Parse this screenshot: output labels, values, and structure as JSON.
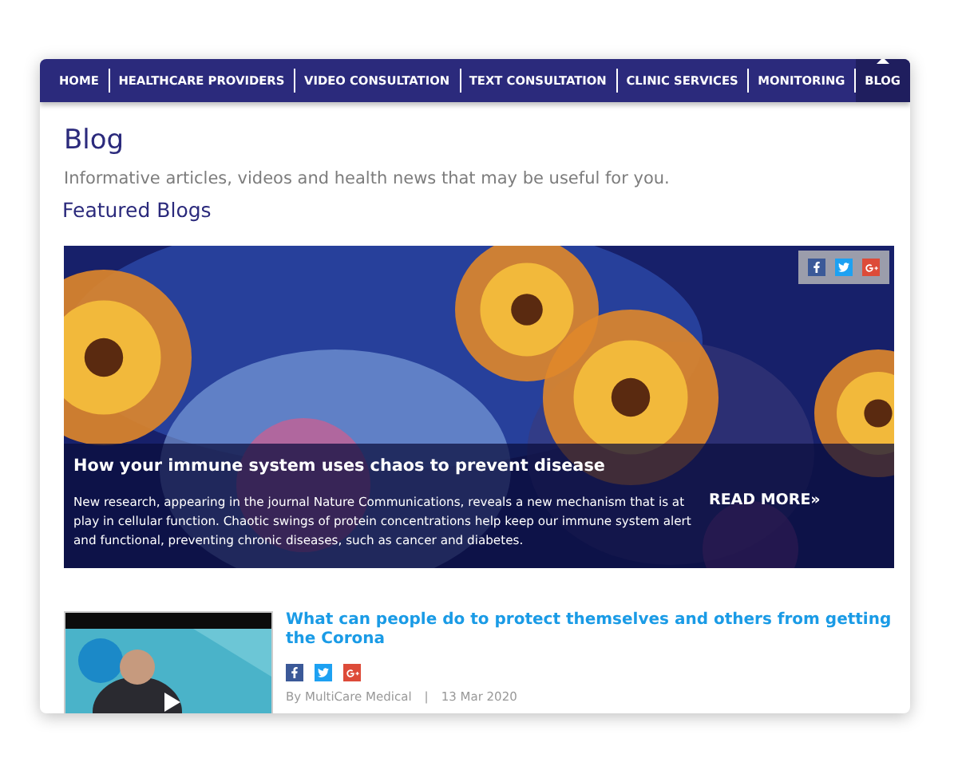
{
  "nav": [
    {
      "label": "HOME",
      "selected": false
    },
    {
      "label": "HEALTHCARE PROVIDERS",
      "selected": false
    },
    {
      "label": "VIDEO CONSULTATION",
      "selected": false
    },
    {
      "label": "TEXT CONSULTATION",
      "selected": false
    },
    {
      "label": "CLINIC SERVICES",
      "selected": false
    },
    {
      "label": "MONITORING",
      "selected": false
    },
    {
      "label": "BLOG",
      "selected": true
    }
  ],
  "page_title": "Blog",
  "intro": "Informative articles, videos and health news that may be useful for you.",
  "section_title": "Featured Blogs",
  "featured": {
    "kind": "picture",
    "title": "How your immune system uses chaos to prevent disease",
    "summary": "New research, appearing in the journal Nature Communications, reveals a new mechanism that is at play in cellular function. Chaotic swings of protein concentrations help keep our immune system alert and functional, preventing chronic diseases, such as cancer and diabetes.",
    "read_more": "READ MORE»"
  },
  "posts": [
    {
      "kind": "video",
      "title": "What can people do to protect themselves and others from getting the Corona",
      "author": "By MultiCare Medical",
      "separator": "|",
      "date": "13 Mar 2020"
    }
  ]
}
